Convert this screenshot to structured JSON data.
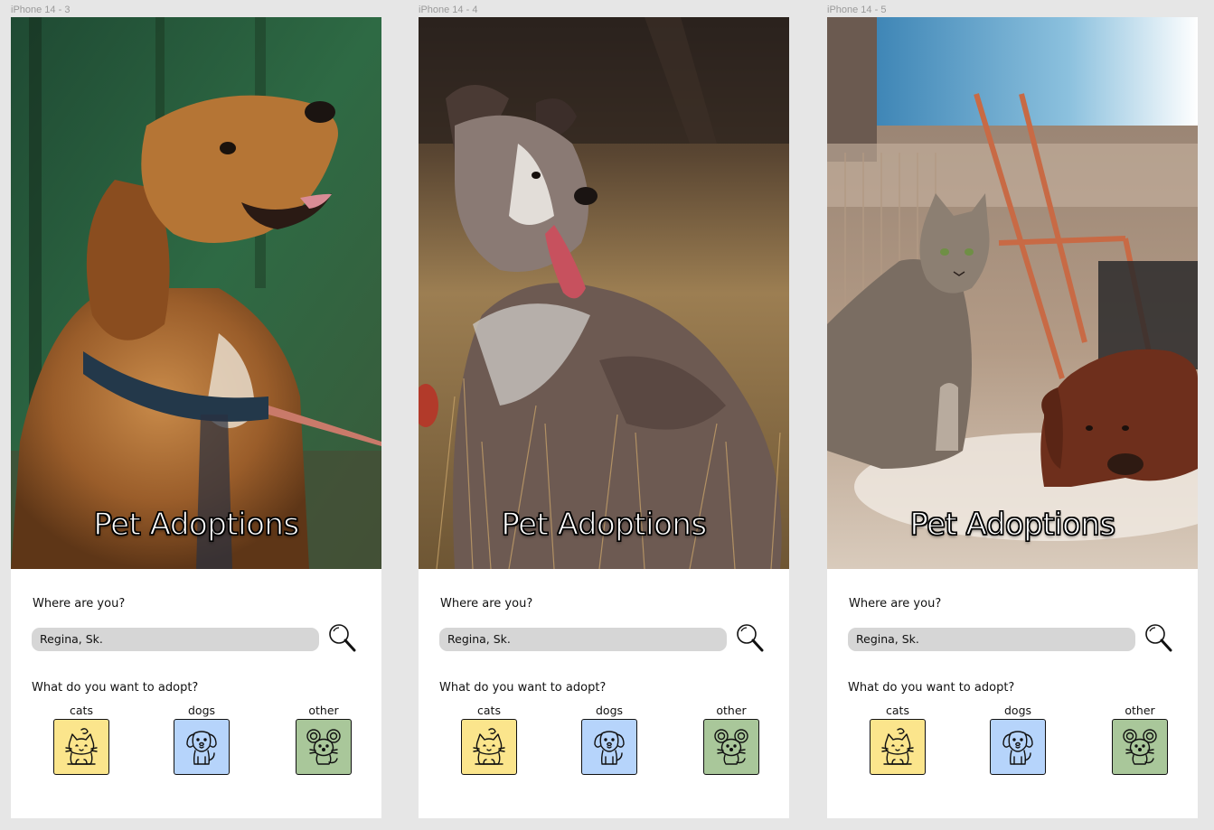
{
  "frames": [
    {
      "label": "iPhone 14 - 3",
      "title": "Pet Adoptions"
    },
    {
      "label": "iPhone 14 - 4",
      "title": "Pet Adoptions"
    },
    {
      "label": "iPhone 14 - 5",
      "title": "Pet Adoptions"
    }
  ],
  "location": {
    "question": "Where are you?",
    "value": "Regina, Sk.",
    "search_icon": "search-icon"
  },
  "adopt": {
    "question": "What do you want to adopt?",
    "options": [
      {
        "label": "cats",
        "icon": "cat-icon",
        "color": "#fbe58c"
      },
      {
        "label": "dogs",
        "icon": "dog-icon",
        "color": "#b6d4fb"
      },
      {
        "label": "other",
        "icon": "mouse-icon",
        "color": "#a9c79a"
      }
    ]
  },
  "photos": [
    "spaniel-dog-photo",
    "border-collie-dog-photo",
    "cat-and-dog-photo"
  ]
}
